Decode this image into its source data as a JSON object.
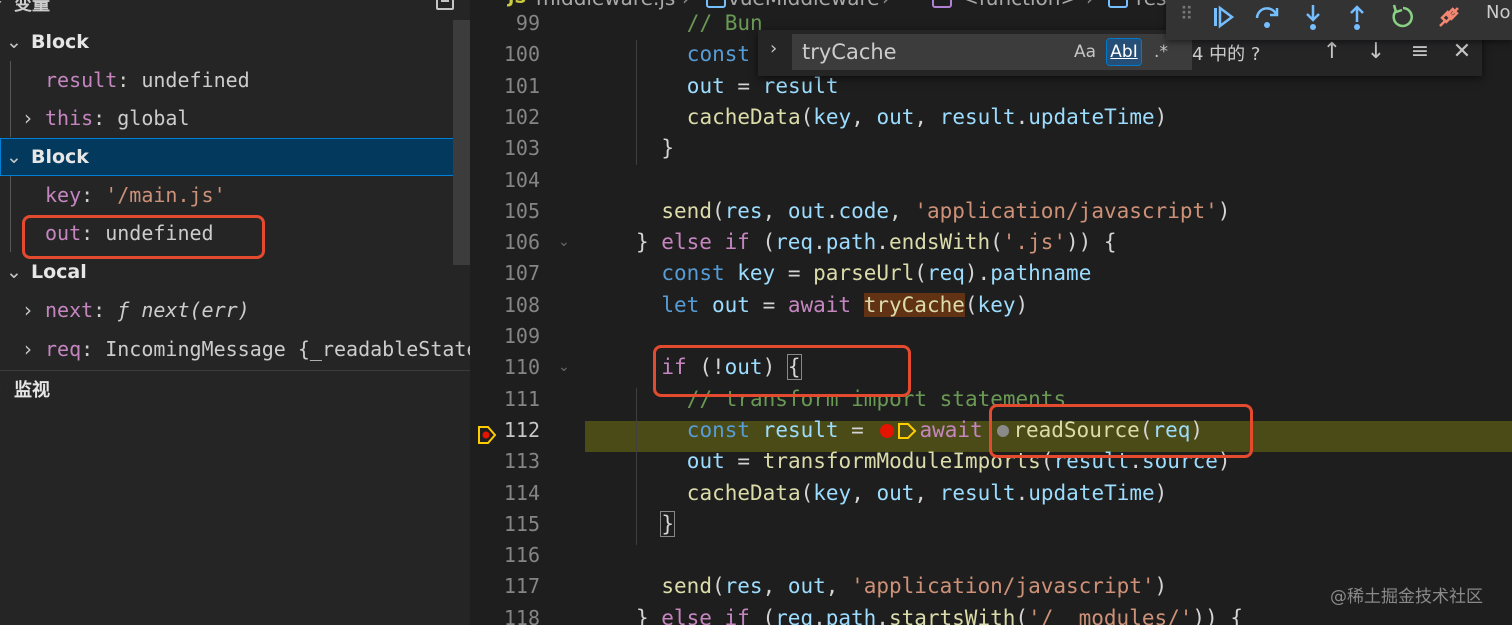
{
  "sidebar": {
    "section_title": "变量",
    "scopes": [
      {
        "label": "Block",
        "expanded": true,
        "vars": [
          {
            "name": "result",
            "value": "undefined",
            "expandable": false
          }
        ]
      },
      {
        "label": "Block",
        "expanded": true,
        "selected": true,
        "vars": [
          {
            "name": "key",
            "value": "'/main.js'",
            "expandable": false
          },
          {
            "name": "out",
            "value": "undefined",
            "expandable": false
          }
        ]
      },
      {
        "label": "Local",
        "expanded": true,
        "vars": [
          {
            "name": "next",
            "value": "ƒ next(err)",
            "expandable": true
          },
          {
            "name": "req",
            "value": "IncomingMessage {_readableState…",
            "expandable": true
          }
        ]
      }
    ],
    "this_var": {
      "name": "this",
      "value": "global",
      "expandable": true
    },
    "watch_title": "监视"
  },
  "breadcrumb": {
    "lang_badge": "JS",
    "file": "middleware.js",
    "symbol1": "vueMiddleware",
    "symbol2": "<function>",
    "symbol3": "res"
  },
  "find_widget": {
    "query": "tryCache",
    "match_case": "Aa",
    "whole_word": "AbI",
    "regex": ".*",
    "count": "4 中的 ?",
    "prev": "↑",
    "next": "↓",
    "selection": "≡",
    "close": "✕",
    "toggle": "›"
  },
  "debug_toolbar": {
    "buttons": [
      "continue",
      "step-over",
      "step-into",
      "step-out",
      "restart",
      "disconnect"
    ],
    "extra_label": "No"
  },
  "editor": {
    "lines": [
      {
        "num": "99",
        "indent": 1,
        "tokens": [
          [
            "cm",
            "// Bun"
          ]
        ]
      },
      {
        "num": "100",
        "indent": 1,
        "tokens": [
          [
            "kw",
            "const"
          ]
        ]
      },
      {
        "num": "101",
        "indent": 1,
        "tokens": [
          [
            "var",
            "out"
          ],
          [
            "pl",
            " = "
          ],
          [
            "var",
            "result"
          ]
        ]
      },
      {
        "num": "102",
        "indent": 1,
        "tokens": [
          [
            "fn",
            "cacheData"
          ],
          [
            "pl",
            "("
          ],
          [
            "var",
            "key"
          ],
          [
            "pl",
            ", "
          ],
          [
            "var",
            "out"
          ],
          [
            "pl",
            ", "
          ],
          [
            "var",
            "result"
          ],
          [
            "pl",
            "."
          ],
          [
            "var",
            "updateTime"
          ],
          [
            "pl",
            ")"
          ]
        ]
      },
      {
        "num": "103",
        "indent": 0,
        "tokens": [
          [
            "pl",
            "}"
          ]
        ]
      },
      {
        "num": "104",
        "indent": 0,
        "tokens": []
      },
      {
        "num": "105",
        "indent": 0,
        "tokens": [
          [
            "fn",
            "send"
          ],
          [
            "pl",
            "("
          ],
          [
            "var",
            "res"
          ],
          [
            "pl",
            ", "
          ],
          [
            "var",
            "out"
          ],
          [
            "pl",
            "."
          ],
          [
            "var",
            "code"
          ],
          [
            "pl",
            ", "
          ],
          [
            "str",
            "'application/javascript'"
          ],
          [
            "pl",
            ")"
          ]
        ]
      },
      {
        "num": "106",
        "indent": -1,
        "fold": true,
        "tokens": [
          [
            "pl",
            "} "
          ],
          [
            "ctl",
            "else"
          ],
          [
            "pl",
            " "
          ],
          [
            "ctl",
            "if"
          ],
          [
            "pl",
            " ("
          ],
          [
            "var",
            "req"
          ],
          [
            "pl",
            "."
          ],
          [
            "var",
            "path"
          ],
          [
            "pl",
            "."
          ],
          [
            "fn",
            "endsWith"
          ],
          [
            "pl",
            "("
          ],
          [
            "str",
            "'.js'"
          ],
          [
            "pl",
            ")) {"
          ]
        ]
      },
      {
        "num": "107",
        "indent": 0,
        "tokens": [
          [
            "kw",
            "const"
          ],
          [
            "pl",
            " "
          ],
          [
            "var",
            "key"
          ],
          [
            "pl",
            " = "
          ],
          [
            "fn",
            "parseUrl"
          ],
          [
            "pl",
            "("
          ],
          [
            "var",
            "req"
          ],
          [
            "pl",
            ")."
          ],
          [
            "var",
            "pathname"
          ]
        ]
      },
      {
        "num": "108",
        "indent": 0,
        "tokens": [
          [
            "kw",
            "let"
          ],
          [
            "pl",
            " "
          ],
          [
            "var",
            "out"
          ],
          [
            "pl",
            " = "
          ],
          [
            "ctl",
            "await"
          ],
          [
            "pl",
            " "
          ],
          [
            "fnhl",
            "tryCache"
          ],
          [
            "pl",
            "("
          ],
          [
            "var",
            "key"
          ],
          [
            "pl",
            ")"
          ]
        ]
      },
      {
        "num": "109",
        "indent": 0,
        "tokens": []
      },
      {
        "num": "110",
        "indent": 0,
        "fold": true,
        "tokens": [
          [
            "ctl",
            "if"
          ],
          [
            "pl",
            " (!"
          ],
          [
            "var",
            "out"
          ],
          [
            "pl",
            ") "
          ],
          [
            "br",
            "{"
          ]
        ]
      },
      {
        "num": "111",
        "indent": 1,
        "tokens": [
          [
            "cm",
            "// transform import statements"
          ]
        ]
      },
      {
        "num": "112",
        "indent": 1,
        "current": true,
        "tokens": [
          [
            "kw",
            "const"
          ],
          [
            "pl",
            " "
          ],
          [
            "var",
            "result"
          ],
          [
            "pl",
            " = "
          ],
          [
            "bp",
            "red"
          ],
          [
            "ia",
            ""
          ],
          [
            "ctl",
            "await"
          ],
          [
            "pl",
            " "
          ],
          [
            "bp",
            "grey"
          ],
          [
            "fn",
            "readSource"
          ],
          [
            "pl",
            "("
          ],
          [
            "var",
            "req"
          ],
          [
            "pl",
            ")"
          ]
        ]
      },
      {
        "num": "113",
        "indent": 1,
        "tokens": [
          [
            "var",
            "out"
          ],
          [
            "pl",
            " = "
          ],
          [
            "fn",
            "transformModuleImports"
          ],
          [
            "pl",
            "("
          ],
          [
            "var",
            "result"
          ],
          [
            "pl",
            "."
          ],
          [
            "var",
            "source"
          ],
          [
            "pl",
            ")"
          ]
        ]
      },
      {
        "num": "114",
        "indent": 1,
        "tokens": [
          [
            "fn",
            "cacheData"
          ],
          [
            "pl",
            "("
          ],
          [
            "var",
            "key"
          ],
          [
            "pl",
            ", "
          ],
          [
            "var",
            "out"
          ],
          [
            "pl",
            ", "
          ],
          [
            "var",
            "result"
          ],
          [
            "pl",
            "."
          ],
          [
            "var",
            "updateTime"
          ],
          [
            "pl",
            ")"
          ]
        ]
      },
      {
        "num": "115",
        "indent": 0,
        "tokens": [
          [
            "br",
            "}"
          ]
        ]
      },
      {
        "num": "116",
        "indent": 0,
        "tokens": []
      },
      {
        "num": "117",
        "indent": 0,
        "tokens": [
          [
            "fn",
            "send"
          ],
          [
            "pl",
            "("
          ],
          [
            "var",
            "res"
          ],
          [
            "pl",
            ", "
          ],
          [
            "var",
            "out"
          ],
          [
            "pl",
            ", "
          ],
          [
            "str",
            "'application/javascript'"
          ],
          [
            "pl",
            ")"
          ]
        ]
      },
      {
        "num": "118",
        "indent": -1,
        "tokens": [
          [
            "pl",
            "} "
          ],
          [
            "ctl",
            "else"
          ],
          [
            "pl",
            " "
          ],
          [
            "ctl",
            "if"
          ],
          [
            "pl",
            " ("
          ],
          [
            "var",
            "req"
          ],
          [
            "pl",
            "."
          ],
          [
            "var",
            "path"
          ],
          [
            "pl",
            "."
          ],
          [
            "fn",
            "startsWith"
          ],
          [
            "pl",
            "("
          ],
          [
            "str",
            "'/__modules/'"
          ],
          [
            "pl",
            ")) {"
          ]
        ]
      }
    ]
  },
  "watermark": "@稀土掘金技术社区",
  "colors": {
    "annotation_box": "#e34a2e",
    "current_line": "#4b4b18",
    "breakpoint": "#e51400",
    "selected_scope": "#04395e"
  }
}
